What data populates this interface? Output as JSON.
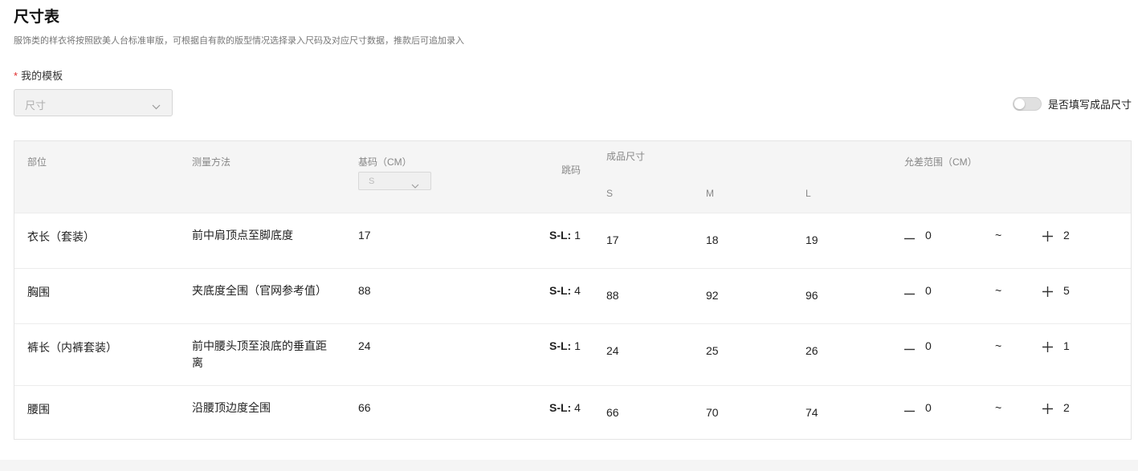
{
  "header": {
    "title": "尺寸表",
    "subtitle": "服饰类的样衣将按照欧美人台标准审版，可根据自有款的版型情况选择录入尺码及对应尺寸数据，推款后可追加录入"
  },
  "template": {
    "required_mark": "*",
    "label": "我的模板",
    "value": "尺寸"
  },
  "toggle": {
    "label": "是否填写成品尺寸",
    "on": false
  },
  "table": {
    "headers": {
      "part": "部位",
      "method": "测量方法",
      "base": "基码（CM）",
      "base_size": "S",
      "jump": "跳码",
      "finished": "成品尺寸",
      "sizes": [
        "S",
        "M",
        "L"
      ],
      "tolerance": "允差范围（CM）"
    },
    "rows": [
      {
        "part": "衣长（套装）",
        "method": "前中肩顶点至脚底度",
        "base": "17",
        "jump_label": "S-L:",
        "jump_value": "1",
        "s": "17",
        "m": "18",
        "l": "19",
        "minus": "0",
        "tilde": "~",
        "plus": "2"
      },
      {
        "part": "胸围",
        "method": "夹底度全围（官网参考值）",
        "base": "88",
        "jump_label": "S-L:",
        "jump_value": "4",
        "s": "88",
        "m": "92",
        "l": "96",
        "minus": "0",
        "tilde": "~",
        "plus": "5"
      },
      {
        "part": "裤长（内裤套装）",
        "method": "前中腰头顶至浪底的垂直距离",
        "base": "24",
        "jump_label": "S-L:",
        "jump_value": "1",
        "s": "24",
        "m": "25",
        "l": "26",
        "minus": "0",
        "tilde": "~",
        "plus": "1"
      },
      {
        "part": "腰围",
        "method": "沿腰顶边度全围",
        "base": "66",
        "jump_label": "S-L:",
        "jump_value": "4",
        "s": "66",
        "m": "70",
        "l": "74",
        "minus": "0",
        "tilde": "~",
        "plus": "2"
      }
    ]
  },
  "colors": {
    "required": "#e02b2b",
    "header_bg": "#f5f5f5",
    "toggle_off": "#e0e0e0"
  },
  "icons": {
    "dropdown": "chevron-down-icon",
    "minus": "minus-icon",
    "plus": "plus-icon"
  }
}
